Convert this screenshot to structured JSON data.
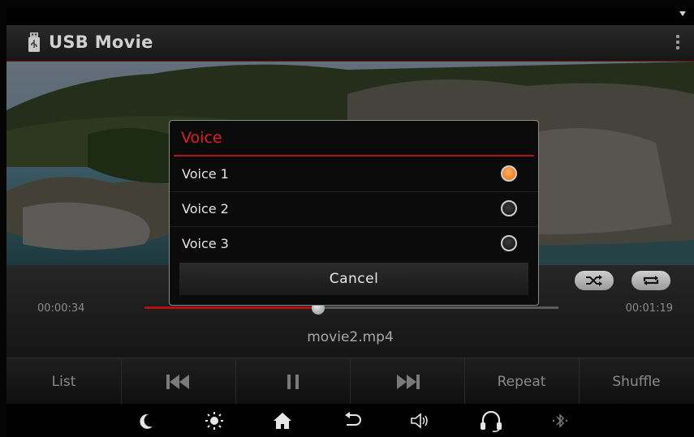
{
  "header": {
    "title": "USB Movie"
  },
  "player": {
    "elapsed": "00:00:34",
    "total": "00:01:19",
    "progress": 0.42,
    "filename": "movie2.mp4"
  },
  "controls": {
    "list_label": "List",
    "repeat_label": "Repeat",
    "shuffle_label": "Shuffle",
    "icons": [
      "prev-track-icon",
      "pause-icon",
      "next-track-icon",
      "shuffle-icon",
      "repeat-icon"
    ]
  },
  "dialog": {
    "title": "Voice",
    "options": [
      {
        "label": "Voice 1",
        "selected": true
      },
      {
        "label": "Voice 2",
        "selected": false
      },
      {
        "label": "Voice 3",
        "selected": false
      }
    ],
    "cancel_label": "Cancel"
  },
  "system_bar": {
    "icons": [
      "night-mode-icon",
      "brightness-icon",
      "home-icon",
      "back-icon",
      "volume-icon",
      "headset-icon",
      "bluetooth-icon"
    ]
  },
  "colors": {
    "accent_red": "#e02020",
    "selected_radio": "#e86a08"
  }
}
